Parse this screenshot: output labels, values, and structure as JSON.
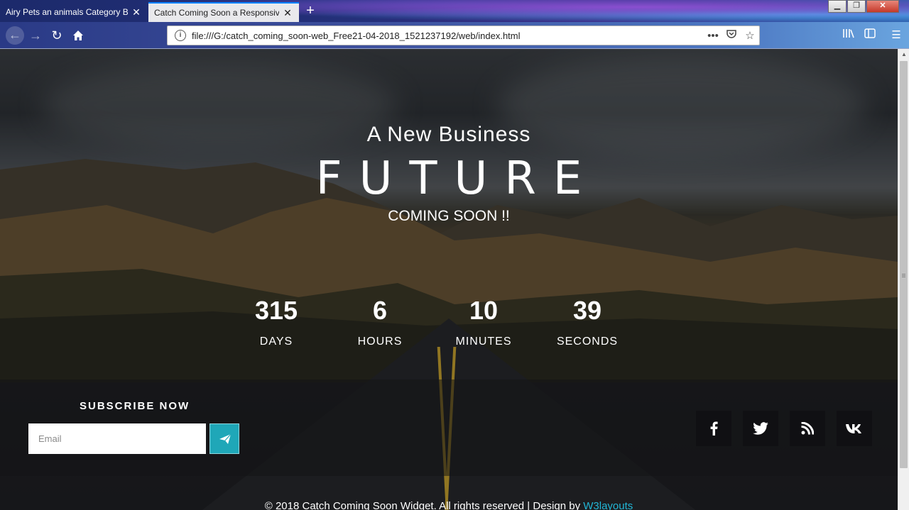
{
  "browser": {
    "tabs": [
      {
        "title": "Airy Pets an animals Category Boot",
        "active": false
      },
      {
        "title": "Catch Coming Soon a Responsive W",
        "active": true
      }
    ],
    "new_tab_label": "+",
    "url": "file:///G:/catch_coming_soon-web_Free21-04-2018_1521237192/web/index.html",
    "window_controls": [
      "minimize-icon",
      "restore-icon",
      "close-icon"
    ],
    "nav_icons": [
      "back-arrow-icon",
      "forward-arrow-icon",
      "reload-icon",
      "home-icon"
    ],
    "url_actions": [
      "page-actions-icon",
      "pocket-icon",
      "bookmark-star-icon"
    ],
    "toolbar_icons": [
      "library-icon",
      "sidebar-icon",
      "menu-icon"
    ]
  },
  "hero": {
    "subtitle": "A New Business",
    "title": "FUTURE",
    "tagline": "COMING SOON !!"
  },
  "countdown": [
    {
      "value": "315",
      "label": "DAYS"
    },
    {
      "value": "6",
      "label": "HOURS"
    },
    {
      "value": "10",
      "label": "MINUTES"
    },
    {
      "value": "39",
      "label": "SECONDS"
    }
  ],
  "subscribe": {
    "title": "SUBSCRIBE NOW",
    "email_placeholder": "Email",
    "email_value": "",
    "submit_icon": "paper-plane-icon",
    "accent_color": "#1fa7b8"
  },
  "social": [
    {
      "name": "facebook-icon",
      "glyph": "f"
    },
    {
      "name": "twitter-icon",
      "glyph": "🐦"
    },
    {
      "name": "rss-icon",
      "glyph": "rss"
    },
    {
      "name": "vk-icon",
      "glyph": "vk"
    }
  ],
  "footer": {
    "text": "© 2018 Catch Coming Soon Widget. All rights reserved | Design by ",
    "link_text": "W3layouts",
    "link_color": "#22b6d6"
  }
}
